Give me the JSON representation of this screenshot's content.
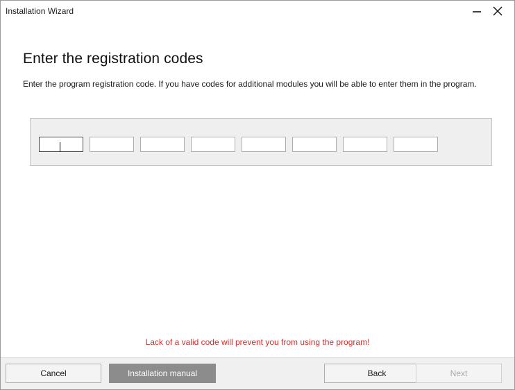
{
  "window": {
    "title": "Installation Wizard",
    "minimize_icon": "minimize-icon",
    "close_icon": "close-icon"
  },
  "main": {
    "heading": "Enter the registration codes",
    "description": "Enter the program registration code. If you have codes for additional modules you will be able to enter them in the program.",
    "code_fields": [
      "",
      "",
      "",
      "",
      "",
      "",
      "",
      ""
    ],
    "warning": "Lack of a valid code will prevent you from using the program!"
  },
  "footer": {
    "cancel_label": "Cancel",
    "manual_label": "Installation manual",
    "back_label": "Back",
    "next_label": "Next"
  },
  "colors": {
    "warning": "#d52b2b",
    "manual_button_bg": "#8c8c8c",
    "panel_bg": "#efefef"
  }
}
